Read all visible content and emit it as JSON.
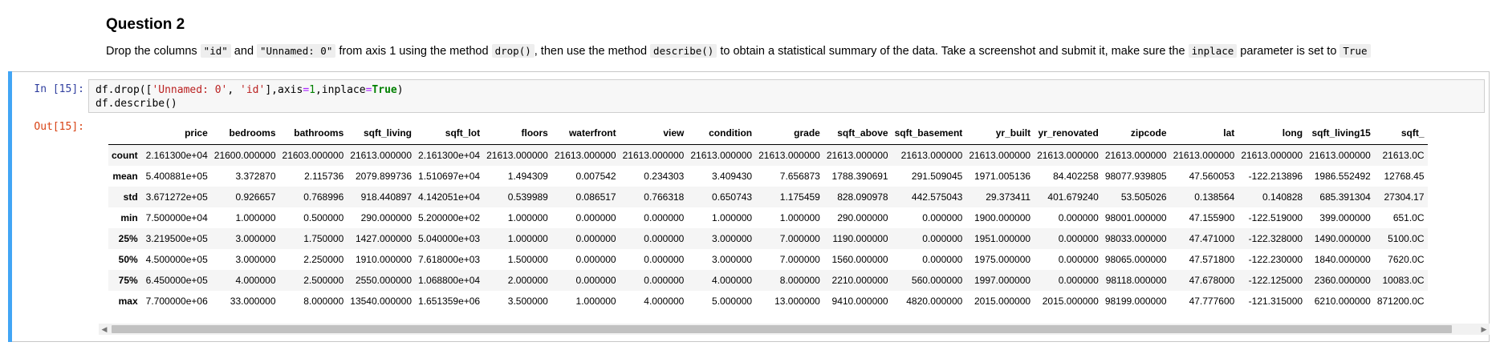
{
  "markdown": {
    "heading": "Question 2",
    "p_1": "Drop the columns ",
    "code_1": "\"id\"",
    "p_2": " and ",
    "code_2": "\"Unnamed: 0\"",
    "p_3": " from axis 1 using the method ",
    "code_3": "drop()",
    "p_4": ", then use the method ",
    "code_4": "describe()",
    "p_5": " to obtain a statistical summary of the data. Take a screenshot and submit it, make sure the ",
    "code_5": "inplace",
    "p_6": " parameter is set to ",
    "code_6": "True"
  },
  "cell": {
    "in_prompt": "In [15]:",
    "out_prompt": "Out[15]:",
    "code": {
      "l1_a": "df.drop([",
      "l1_s1": "'Unnamed: 0'",
      "l1_b": ", ",
      "l1_s2": "'id'",
      "l1_c": "],axis",
      "l1_eq1": "=",
      "l1_one": "1",
      "l1_d": ",inplace",
      "l1_eq2": "=",
      "l1_true": "True",
      "l1_e": ")",
      "l2": "df.describe()"
    }
  },
  "table": {
    "columns": [
      "price",
      "bedrooms",
      "bathrooms",
      "sqft_living",
      "sqft_lot",
      "floors",
      "waterfront",
      "view",
      "condition",
      "grade",
      "sqft_above",
      "sqft_basement",
      "yr_built",
      "yr_renovated",
      "zipcode",
      "lat",
      "long",
      "sqft_living15",
      "sqft_"
    ],
    "rows": [
      {
        "label": "count",
        "cells": [
          "2.161300e+04",
          "21600.000000",
          "21603.000000",
          "21613.000000",
          "2.161300e+04",
          "21613.000000",
          "21613.000000",
          "21613.000000",
          "21613.000000",
          "21613.000000",
          "21613.000000",
          "21613.000000",
          "21613.000000",
          "21613.000000",
          "21613.000000",
          "21613.000000",
          "21613.000000",
          "21613.000000",
          "21613.0C"
        ]
      },
      {
        "label": "mean",
        "cells": [
          "5.400881e+05",
          "3.372870",
          "2.115736",
          "2079.899736",
          "1.510697e+04",
          "1.494309",
          "0.007542",
          "0.234303",
          "3.409430",
          "7.656873",
          "1788.390691",
          "291.509045",
          "1971.005136",
          "84.402258",
          "98077.939805",
          "47.560053",
          "-122.213896",
          "1986.552492",
          "12768.45"
        ]
      },
      {
        "label": "std",
        "cells": [
          "3.671272e+05",
          "0.926657",
          "0.768996",
          "918.440897",
          "4.142051e+04",
          "0.539989",
          "0.086517",
          "0.766318",
          "0.650743",
          "1.175459",
          "828.090978",
          "442.575043",
          "29.373411",
          "401.679240",
          "53.505026",
          "0.138564",
          "0.140828",
          "685.391304",
          "27304.17"
        ]
      },
      {
        "label": "min",
        "cells": [
          "7.500000e+04",
          "1.000000",
          "0.500000",
          "290.000000",
          "5.200000e+02",
          "1.000000",
          "0.000000",
          "0.000000",
          "1.000000",
          "1.000000",
          "290.000000",
          "0.000000",
          "1900.000000",
          "0.000000",
          "98001.000000",
          "47.155900",
          "-122.519000",
          "399.000000",
          "651.0C"
        ]
      },
      {
        "label": "25%",
        "cells": [
          "3.219500e+05",
          "3.000000",
          "1.750000",
          "1427.000000",
          "5.040000e+03",
          "1.000000",
          "0.000000",
          "0.000000",
          "3.000000",
          "7.000000",
          "1190.000000",
          "0.000000",
          "1951.000000",
          "0.000000",
          "98033.000000",
          "47.471000",
          "-122.328000",
          "1490.000000",
          "5100.0C"
        ]
      },
      {
        "label": "50%",
        "cells": [
          "4.500000e+05",
          "3.000000",
          "2.250000",
          "1910.000000",
          "7.618000e+03",
          "1.500000",
          "0.000000",
          "0.000000",
          "3.000000",
          "7.000000",
          "1560.000000",
          "0.000000",
          "1975.000000",
          "0.000000",
          "98065.000000",
          "47.571800",
          "-122.230000",
          "1840.000000",
          "7620.0C"
        ]
      },
      {
        "label": "75%",
        "cells": [
          "6.450000e+05",
          "4.000000",
          "2.500000",
          "2550.000000",
          "1.068800e+04",
          "2.000000",
          "0.000000",
          "0.000000",
          "4.000000",
          "8.000000",
          "2210.000000",
          "560.000000",
          "1997.000000",
          "0.000000",
          "98118.000000",
          "47.678000",
          "-122.125000",
          "2360.000000",
          "10083.0C"
        ]
      },
      {
        "label": "max",
        "cells": [
          "7.700000e+06",
          "33.000000",
          "8.000000",
          "13540.000000",
          "1.651359e+06",
          "3.500000",
          "1.000000",
          "4.000000",
          "5.000000",
          "13.000000",
          "9410.000000",
          "4820.000000",
          "2015.000000",
          "2015.000000",
          "98199.000000",
          "47.777600",
          "-121.315000",
          "6210.000000",
          "871200.0C"
        ]
      }
    ]
  },
  "colors": {
    "cell_bar": "#42a5f5",
    "in_prompt": "#303f9f",
    "out_prompt": "#d84315"
  },
  "icons": {
    "scroll_left": "◀",
    "scroll_right": "▶"
  }
}
